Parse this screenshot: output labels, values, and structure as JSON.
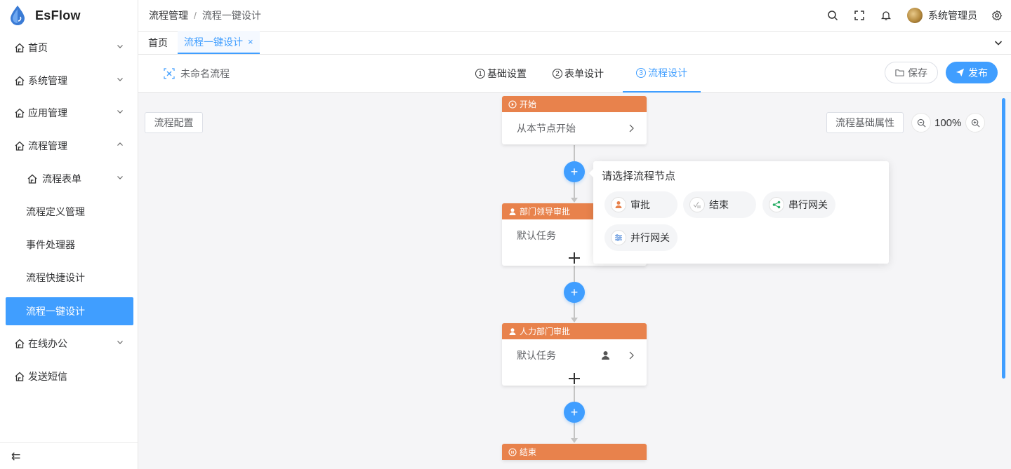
{
  "app": {
    "name": "EsFlow"
  },
  "sidebar": {
    "items": [
      {
        "label": "首页"
      },
      {
        "label": "系统管理"
      },
      {
        "label": "应用管理"
      },
      {
        "label": "流程管理"
      },
      {
        "label": "流程表单"
      },
      {
        "label": "流程定义管理"
      },
      {
        "label": "事件处理器"
      },
      {
        "label": "流程快捷设计"
      },
      {
        "label": "流程一键设计"
      },
      {
        "label": "在线办公"
      },
      {
        "label": "发送短信"
      }
    ],
    "collapse_icon": "⇇"
  },
  "header": {
    "breadcrumb": [
      "流程管理",
      "/",
      "流程一键设计"
    ],
    "user_name": "系统管理员"
  },
  "tags": [
    {
      "label": "首页"
    },
    {
      "label": "流程一键设计",
      "close": "×"
    }
  ],
  "designer": {
    "flow_name": "未命名流程",
    "steps": [
      {
        "num": "1",
        "label": "基础设置"
      },
      {
        "num": "2",
        "label": "表单设计"
      },
      {
        "num": "3",
        "label": "流程设计"
      }
    ],
    "save_label": "保存",
    "publish_label": "发布"
  },
  "canvas": {
    "config_label": "流程配置",
    "props_label": "流程基础属性",
    "zoom": "100%",
    "nodes": [
      {
        "title": "开始",
        "body": "从本节点开始"
      },
      {
        "title": "部门领导审批",
        "body": "默认任务"
      },
      {
        "title": "人力部门审批",
        "body": "默认任务"
      },
      {
        "title": "结束"
      }
    ],
    "plus_glyph": "+"
  },
  "popover": {
    "title": "请选择流程节点",
    "options": [
      {
        "label": "审批",
        "icon": "approve-icon"
      },
      {
        "label": "结束",
        "icon": "end-icon"
      },
      {
        "label": "串行网关",
        "icon": "serial-gateway-icon"
      },
      {
        "label": "并行网关",
        "icon": "parallel-gateway-icon"
      }
    ]
  },
  "colors": {
    "primary": "#409eff",
    "node_header": "#e8824c",
    "canvas_bg": "#f5f5f7",
    "serial_green": "#2aae67"
  }
}
